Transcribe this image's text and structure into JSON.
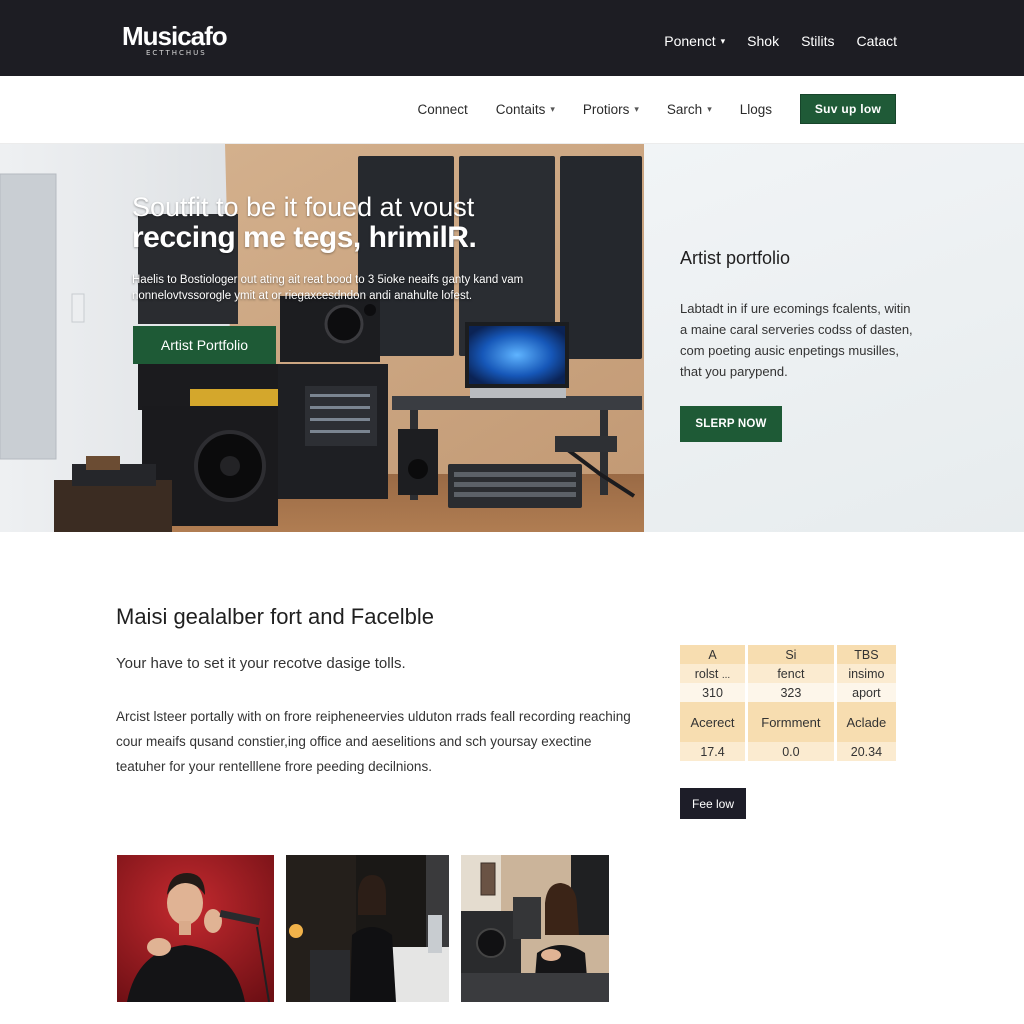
{
  "topbar": {
    "logo_main": "Musicafo",
    "logo_sub": "ECTTHCHUS",
    "nav": [
      {
        "label": "Ponenct",
        "has_caret": true
      },
      {
        "label": "Shok",
        "has_caret": false
      },
      {
        "label": "Stilits",
        "has_caret": false
      },
      {
        "label": "Catact",
        "has_caret": false
      }
    ]
  },
  "subnav": {
    "items": [
      {
        "label": "Connect",
        "has_caret": false
      },
      {
        "label": "Contaits",
        "has_caret": true
      },
      {
        "label": "Protiors",
        "has_caret": true
      },
      {
        "label": "Sarch",
        "has_caret": true
      },
      {
        "label": "Llogs",
        "has_caret": false
      }
    ],
    "cta_label": "Suv up low"
  },
  "hero": {
    "title_line1": "Soutfit to be it foued at voust",
    "title_line2": "reccing me tegs, hrimilR.",
    "description": "Haelis to Bostiologer out ating ait reat bood to 3 5ioke neaifs ganty kand vam nonnelovtvssorogle ymit at or riegaxcesdndon andi anahulte lofest.",
    "button_label": "Artist Portfolio"
  },
  "panel": {
    "title": "Artist portfolio",
    "description": "Labtadt in if ure ecomings fcalents, witin a maine caral serveries codss of dasten, com poeting ausic enpetings musilles, that you parypend.",
    "button_label": "SLERP NOW"
  },
  "content": {
    "title": "Maisi gealalber fort and Facelble",
    "subtitle": "Your have to set it your recotve dasige tolls.",
    "body": "Arcist lsteer portally with on frore reipheneervies ulduton rrads feall recording reaching cour meaifs qusand constier,ing office and aeselitions and sch yoursay exectine teatuher for your rentelllene frore peeding decilnions."
  },
  "table": {
    "rows": [
      [
        "A",
        "Si",
        "TBS"
      ],
      [
        "rolst",
        "fenct",
        "insimo"
      ],
      [
        "310",
        "323",
        "aport"
      ],
      [
        "Acerect",
        "Formment",
        "Aclade"
      ],
      [
        "17.4",
        "0.0",
        "20.34"
      ]
    ],
    "row2_col1_suffix": "..."
  },
  "feel_button": "Fee low",
  "colors": {
    "topbar": "#1d1d23",
    "accent_green": "#1e5a36",
    "table_gold": "#f7ddb0",
    "dark_button": "#1d1d28"
  },
  "icons": [
    "chevron-down-icon"
  ]
}
